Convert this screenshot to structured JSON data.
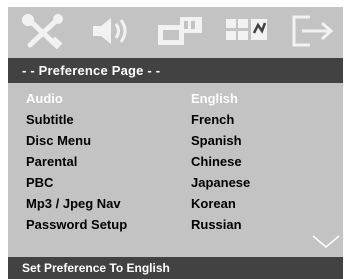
{
  "header": {
    "icons": [
      "tools-settings-icon",
      "speaker-audio-icon",
      "video-display-icon",
      "preference-grid-icon",
      "exit-icon"
    ]
  },
  "page": {
    "title": "- -   Preference Page   - -"
  },
  "menu": {
    "items": [
      {
        "label": "Audio",
        "value": "English",
        "highlighted": true
      },
      {
        "label": "Subtitle",
        "value": "French"
      },
      {
        "label": "Disc Menu",
        "value": "Spanish"
      },
      {
        "label": "Parental",
        "value": "Chinese"
      },
      {
        "label": "PBC",
        "value": "Japanese"
      },
      {
        "label": "Mp3 / Jpeg Nav",
        "value": "Korean"
      },
      {
        "label": "Password Setup",
        "value": "Russian"
      }
    ],
    "more_icon": "down-arrow-icon"
  },
  "status": {
    "text": "Set Preference To English"
  },
  "colors": {
    "panel": "#c3c3c3",
    "bar": "#424242",
    "highlight_text": "#ffffff",
    "text": "#000000"
  }
}
